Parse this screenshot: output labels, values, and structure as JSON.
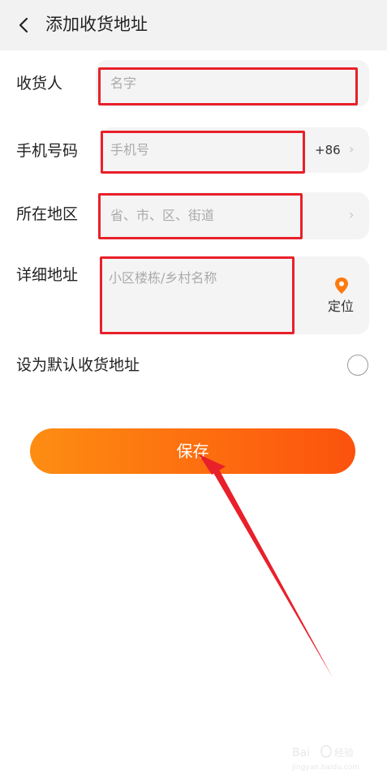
{
  "header": {
    "title": "添加收货地址",
    "back_icon": "chevron-left-icon"
  },
  "form": {
    "recipient": {
      "label": "收货人",
      "placeholder": "名字"
    },
    "phone": {
      "label": "手机号码",
      "placeholder": "手机号",
      "country_code": "+86"
    },
    "region": {
      "label": "所在地区",
      "placeholder": "省、市、区、街道"
    },
    "detail": {
      "label": "详细地址",
      "placeholder": "小区楼栋/乡村名称",
      "locate_label": "定位"
    },
    "default": {
      "label": "设为默认收货地址",
      "checked": false
    }
  },
  "save_button": {
    "label": "保存"
  },
  "colors": {
    "accent": "#fd6a0f",
    "highlight": "#e8202a",
    "locate_icon": "#fd7a0f"
  },
  "watermark_text": "Baidu 经验 jingyan.baidu.com"
}
